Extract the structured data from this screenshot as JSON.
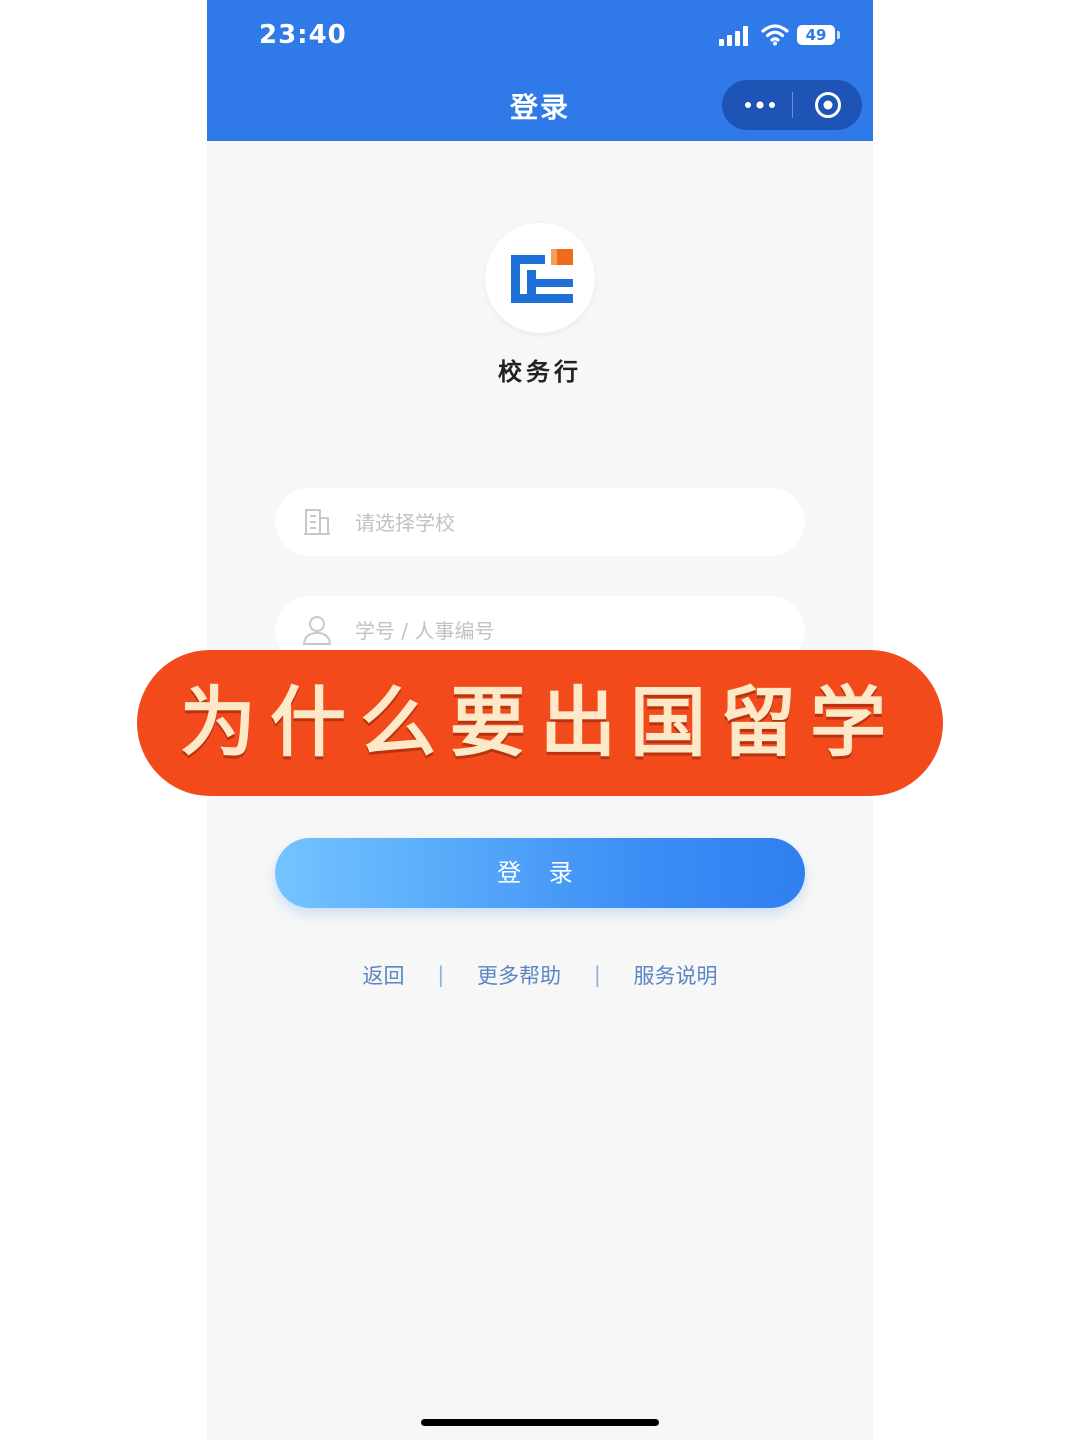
{
  "status_bar": {
    "time": "23:40",
    "battery": "49"
  },
  "nav": {
    "title": "登录"
  },
  "app": {
    "name": "校务行"
  },
  "form": {
    "school_placeholder": "请选择学校",
    "id_placeholder": "学号 / 人事编号",
    "login_label": "登 录"
  },
  "overlay": {
    "banner_text": "为什么要出国留学"
  },
  "links": {
    "items": [
      "返回",
      "更多帮助",
      "服务说明"
    ],
    "separator": "|"
  },
  "colors": {
    "header": "#2f79e8",
    "banner": "#f24a1b",
    "banner_text": "#fde8c8",
    "link": "#5b86c4"
  }
}
